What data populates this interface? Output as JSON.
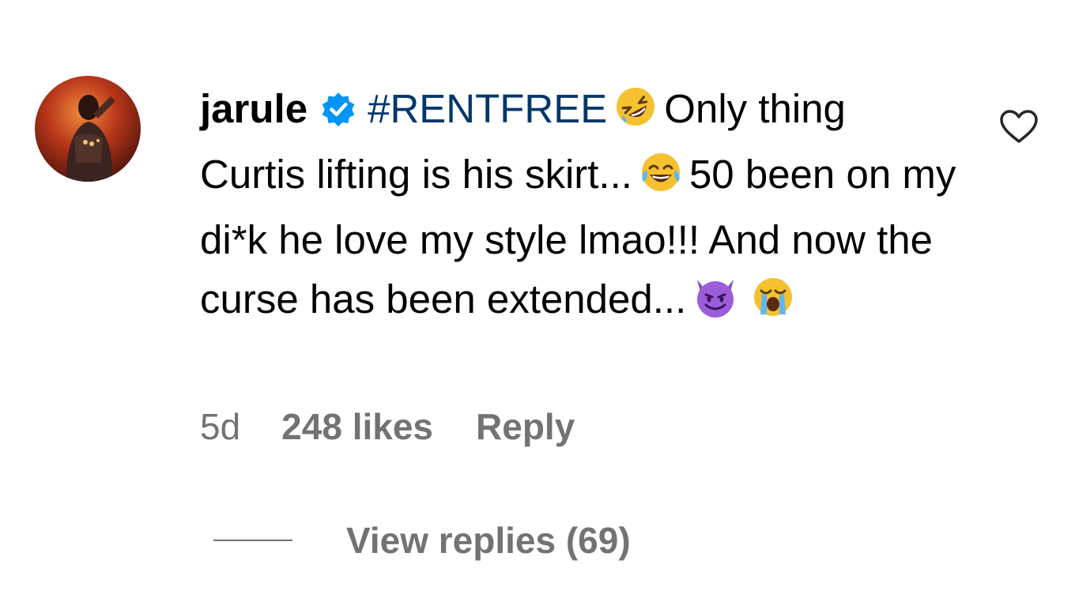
{
  "comment": {
    "username": "jarule",
    "verified_icon": "verified-badge-icon",
    "hashtag": "#RENTFREE",
    "text_1": "Only thing Curtis lifting is his skirt...",
    "text_2": "50 been on my di*k he love my style lmao!!! And now the curse has been extended...",
    "emojis": [
      "rolling-on-floor-laughing",
      "tears-of-joy",
      "smiling-imp",
      "loudly-crying"
    ],
    "time": "5d",
    "likes": "248 likes",
    "reply_label": "Reply",
    "view_replies": "View replies (69)"
  },
  "icons": {
    "like": "heart-outline-icon"
  },
  "colors": {
    "hashtag": "#00376b",
    "verified": "#0095f6",
    "meta_text": "#737373"
  }
}
